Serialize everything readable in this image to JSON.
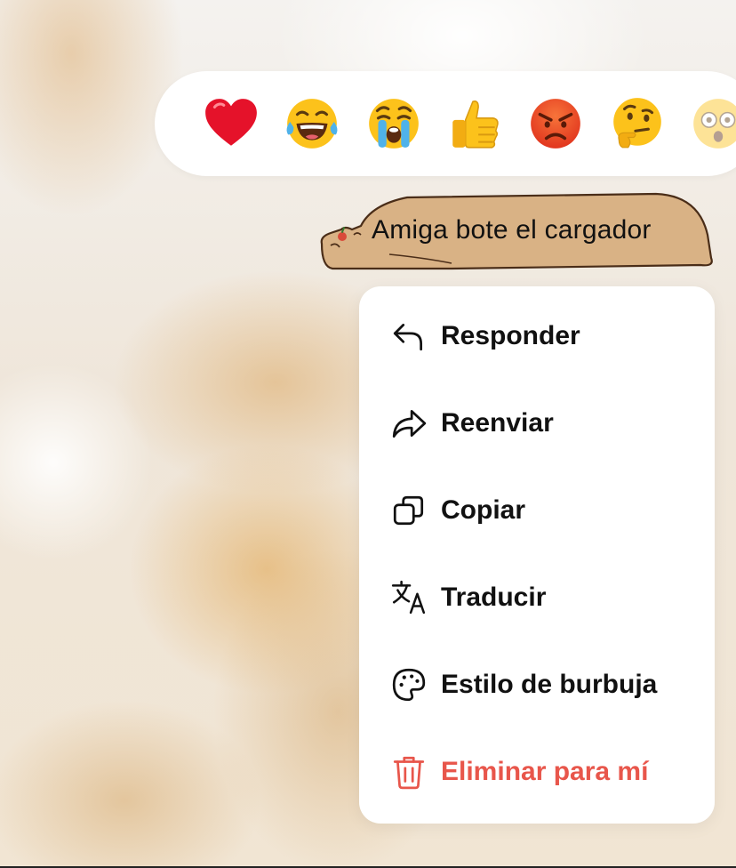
{
  "reactions": [
    {
      "name": "red-heart-icon",
      "label": "Red heart"
    },
    {
      "name": "tears-of-joy-icon",
      "label": "Face with tears of joy"
    },
    {
      "name": "crying-face-icon",
      "label": "Loudly crying face"
    },
    {
      "name": "thumbs-up-icon",
      "label": "Thumbs up"
    },
    {
      "name": "angry-face-icon",
      "label": "Angry face"
    },
    {
      "name": "thinking-face-icon",
      "label": "Thinking face"
    },
    {
      "name": "astonished-face-icon",
      "label": "Astonished face"
    }
  ],
  "message": {
    "text": "Amiga bote el cargador"
  },
  "menu": {
    "items": [
      {
        "label": "Responder",
        "icon": "reply-icon"
      },
      {
        "label": "Reenviar",
        "icon": "forward-icon"
      },
      {
        "label": "Copiar",
        "icon": "copy-icon"
      },
      {
        "label": "Traducir",
        "icon": "translate-icon"
      },
      {
        "label": "Estilo de burbuja",
        "icon": "palette-icon"
      },
      {
        "label": "Eliminar para mí",
        "icon": "trash-icon",
        "danger": true
      }
    ]
  },
  "colors": {
    "danger": "#e8564b",
    "bubble_fill": "#d9b285",
    "bubble_outline": "#4a2d18"
  }
}
